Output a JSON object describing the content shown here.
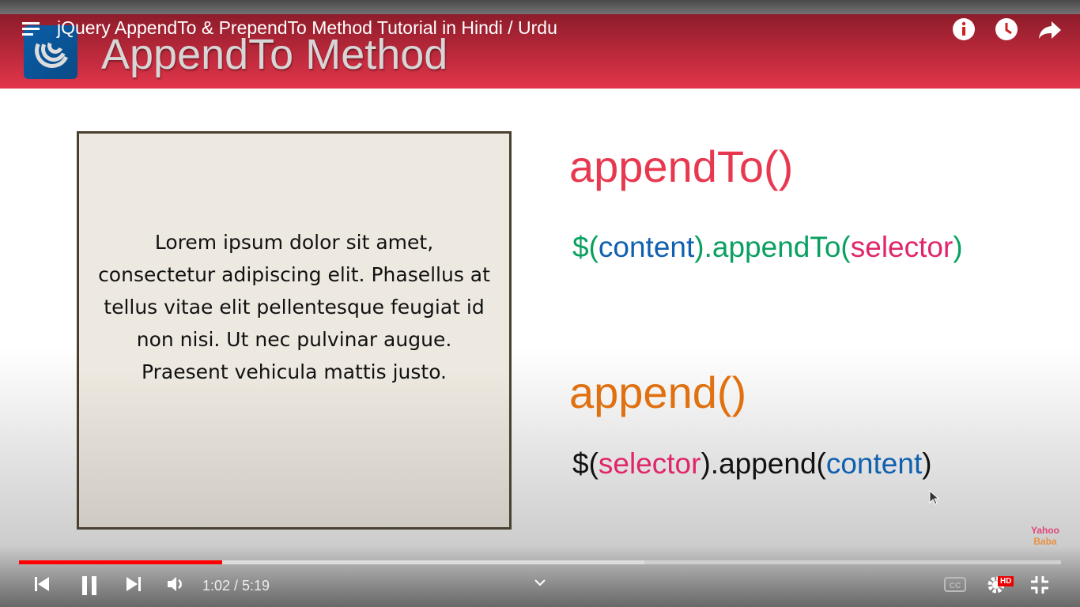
{
  "video": {
    "title": "jQuery AppendTo & PrependTo Method Tutorial in Hindi / Urdu"
  },
  "slide": {
    "heading": "AppendTo Method",
    "lorem": "Lorem ipsum dolor sit amet, consectetur adipiscing elit. Phasellus at tellus vitae elit pellentesque feugiat id non nisi. Ut nec pulvinar augue. Praesent vehicula mattis justo.",
    "appendTo_heading": "appendTo()",
    "appendTo_code": {
      "p1": "$(",
      "p2": "content",
      "p3": ").appendTo(",
      "p4": "selector",
      "p5": ")"
    },
    "append_heading": "append()",
    "append_code": {
      "p1": "$(",
      "p2": "selector",
      "p3": ").append(",
      "p4": "content",
      "p5": ")"
    },
    "watermark": {
      "line1": "Yahoo",
      "line2": "Baba"
    }
  },
  "player": {
    "current_time": "1:02",
    "duration": "5:19",
    "time_label": "1:02 / 5:19",
    "played_fraction": 0.195,
    "buffered_fraction": 0.6,
    "quality_badge": "HD"
  },
  "colors": {
    "accent": "#ff0000",
    "banner": "#e2354a"
  }
}
